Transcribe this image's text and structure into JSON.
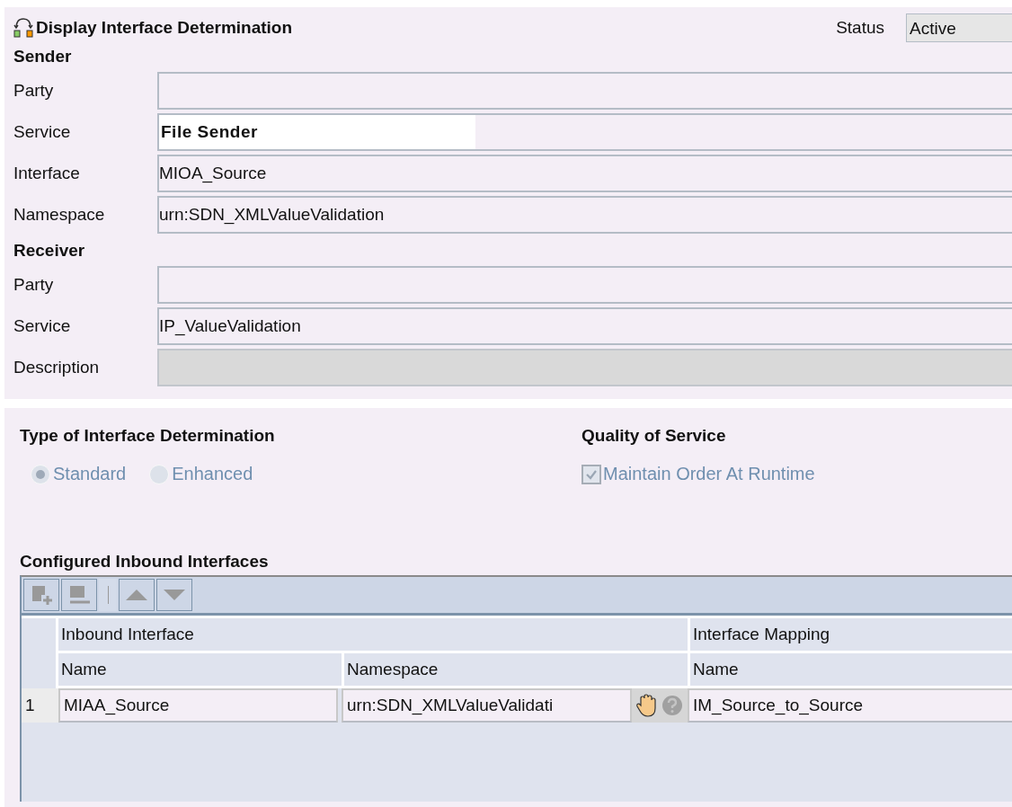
{
  "header": {
    "title": "Display Interface Determination",
    "status_label": "Status",
    "status_value": "Active"
  },
  "sections": [
    {
      "title": "Sender",
      "fields": [
        {
          "label": "Party",
          "emphasized": false,
          "disabled": false
        },
        {
          "label": "Service",
          "value": "File Sender",
          "emphasized": true,
          "disabled": false
        },
        {
          "label": "Interface",
          "value": "MIOA_Source",
          "emphasized": false,
          "disabled": false
        },
        {
          "label": "Namespace",
          "value": "urn:SDN_XMLValueValidation",
          "emphasized": false,
          "disabled": false
        }
      ]
    },
    {
      "title": "Receiver",
      "fields": [
        {
          "label": "Party",
          "emphasized": false,
          "disabled": false
        },
        {
          "label": "Service",
          "value": "IP_ValueValidation",
          "emphasized": false,
          "disabled": false
        },
        {
          "label": "Description",
          "emphasized": false,
          "disabled": true
        }
      ]
    }
  ],
  "determination_type": {
    "title": "Type of Interface Determination",
    "disabled": true,
    "options": [
      {
        "label": "Standard",
        "selected": true
      },
      {
        "label": "Enhanced",
        "selected": false
      }
    ]
  },
  "quality_of_service": {
    "title": "Quality of Service",
    "disabled": true,
    "option": {
      "label": "Maintain Order At Runtime",
      "checked": true
    }
  },
  "inbound_interfaces": {
    "title": "Configured Inbound Interfaces",
    "group_headers": [
      "Inbound Interface",
      "Interface Mapping"
    ],
    "columns": [
      "Name",
      "Namespace",
      "Name"
    ],
    "rows": [
      {
        "number": "1",
        "name": "MIAA_Source",
        "namespace": "urn:SDN_XMLValueValidati",
        "mapping": "IM_Source_to_Source"
      }
    ]
  }
}
